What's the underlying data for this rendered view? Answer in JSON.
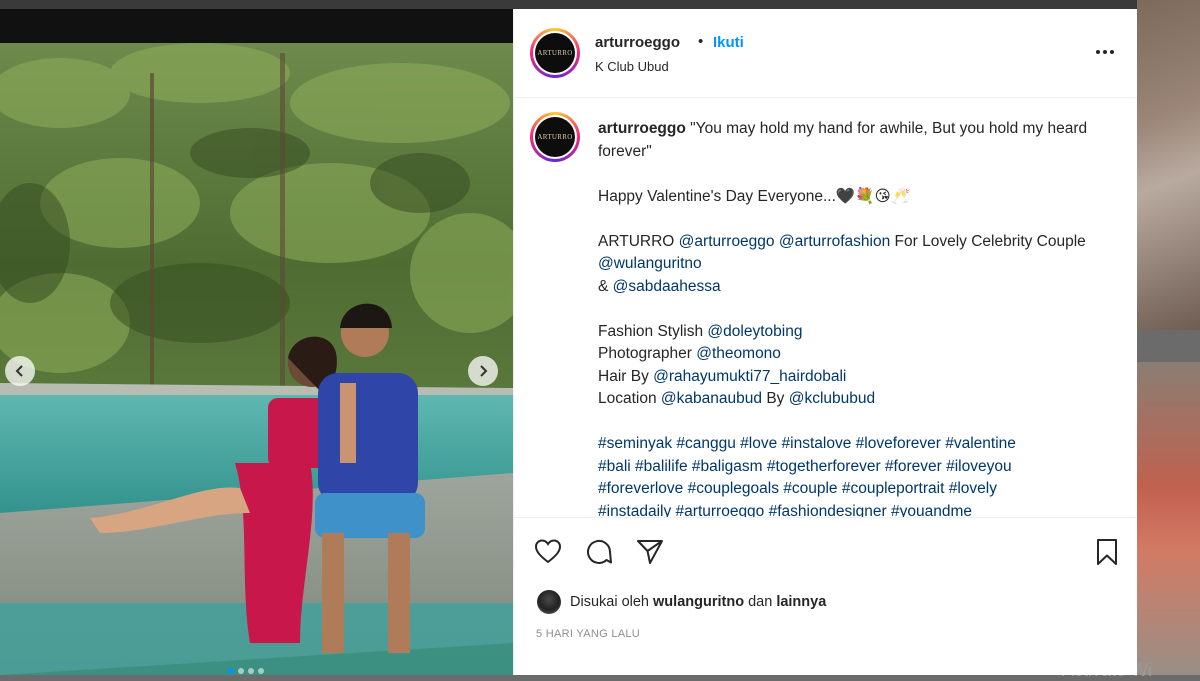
{
  "post": {
    "username": "arturroeggo",
    "separator": "•",
    "follow_label": "Ikuti",
    "location": "K Club Ubud",
    "avatar_text": "ARTURRO",
    "caption": {
      "username": "arturroeggo",
      "quote": "\"You may hold my hand for awhile, But you hold my heard forever\"",
      "greeting": "Happy Valentine's Day Everyone...🖤💐😘🥂",
      "credits_prefix": "ARTURRO",
      "mention_1": "@arturroeggo",
      "mention_2": "@arturrofashion",
      "credits_mid": "For Lovely Celebrity Couple",
      "mention_3": "@wulanguritno",
      "amp": "&",
      "mention_4": "@sabdaahessa",
      "stylist_label": "Fashion Stylish",
      "stylist": "@doleytobing",
      "photographer_label": "Photographer",
      "photographer": "@theomono",
      "hair_label": "Hair By",
      "hair": "@rahayumukti77_hairdobali",
      "location_label": "Location",
      "location_1": "@kabanaubud",
      "by_label": "By",
      "location_2": "@kclububud",
      "hashtags_1": "#seminyak #canggu #love #instalove #loveforever #valentine",
      "hashtags_2": "#bali #balilife #baligasm #togetherforever #forever #iloveyou",
      "hashtags_3": "#foreverlove #couplegoals #couple #coupleportrait #lovely",
      "hashtags_4": "#instadaily #arturroeggo #fashiondesigner #youandme"
    },
    "likes": {
      "prefix": "Disukai oleh",
      "user": "wulanguritno",
      "mid": "dan",
      "others": "lainnya"
    },
    "timestamp": "5 HARI YANG LALU",
    "carousel": {
      "slides": 4,
      "active_index": 0
    }
  },
  "background": {
    "watermark": "Activate Wi"
  },
  "icons": {
    "like": "heart-icon",
    "comment": "comment-icon",
    "share": "share-icon",
    "save": "bookmark-icon",
    "more": "more-options-icon",
    "prev": "chevron-left-icon",
    "next": "chevron-right-icon"
  },
  "colors": {
    "link": "#00376b",
    "follow": "#0095f6",
    "text": "#262626",
    "muted": "#8e8e8e"
  }
}
